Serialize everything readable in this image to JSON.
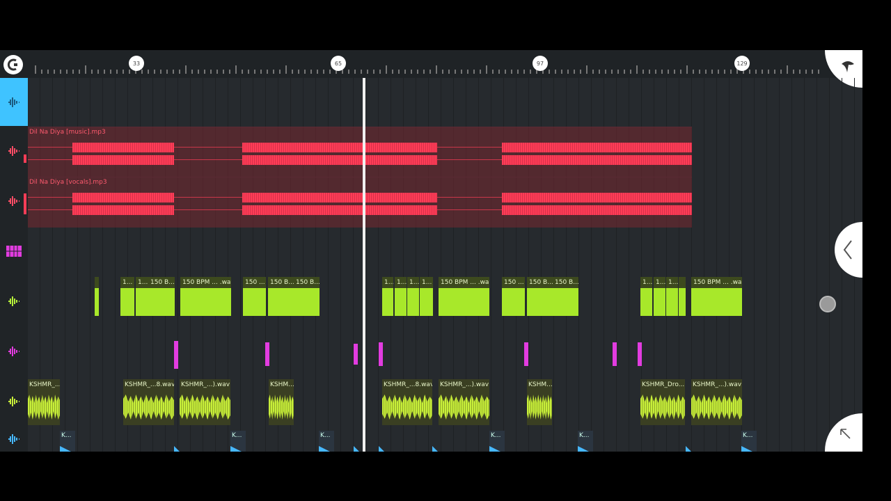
{
  "ruler": {
    "markers": [
      "33",
      "65",
      "97",
      "129"
    ]
  },
  "tracks": {
    "music": {
      "label": "Dil Na Diya  [music].mp3",
      "color": "#ff3d57"
    },
    "vocals": {
      "label": "Dil Na Diya  [vocals].mp3",
      "color": "#ff3d57"
    },
    "loops": {
      "color": "#a8e82a",
      "clips": [
        "",
        "1...",
        "1...",
        "150 B...",
        "150 BPM ... .wav",
        "150 ...",
        "150 B...",
        "150 B...",
        "1...",
        "1...",
        "1...",
        "1...",
        "150 BPM ... .wav",
        "150 ...",
        "150 B...",
        "150 B...",
        "1...",
        "1...",
        "1...",
        "",
        "150 BPM ... .wav"
      ]
    },
    "perc": {
      "color": "#e23ce0"
    },
    "kshmr": {
      "color": "#c8ef3a",
      "clips": [
        "KSHMR_...",
        "KSHMR_...8.wav",
        "KSHMR_...).wav",
        "KSHM...",
        "KSHMR_...8.wav",
        "KSHMR_...).wav",
        "KSHM...",
        "KSHMR_Dro...",
        "KSHMR_...).wav"
      ]
    },
    "kicks": {
      "color": "#47b8ff",
      "clips": [
        "K...",
        "K...",
        "K...",
        "K...",
        "K...",
        "K..."
      ]
    }
  },
  "icons": [
    "snap-icon",
    "fl-fruit-icon",
    "chevron-left-icon",
    "arrow-up-left-icon",
    "waveform-icon",
    "pattern-grid-icon"
  ]
}
